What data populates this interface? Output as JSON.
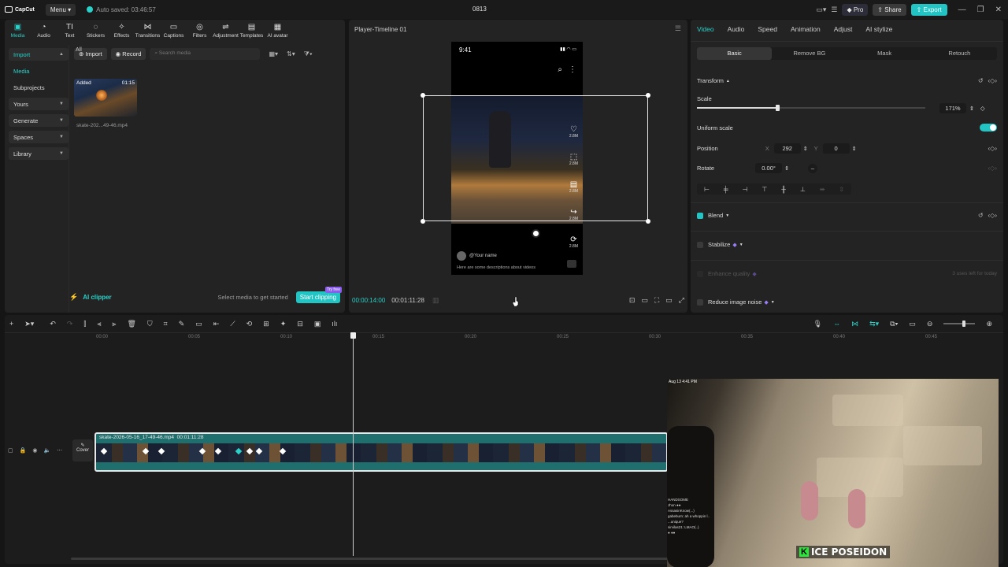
{
  "topbar": {
    "logo": "CapCut",
    "menu": "Menu",
    "autosave": "Auto saved: 03:46:57",
    "doc_title": "0813",
    "pro": "Pro",
    "share": "Share",
    "export": "Export"
  },
  "left": {
    "tools": [
      {
        "label": "Media",
        "icon": "media-icon",
        "glyph": "▣"
      },
      {
        "label": "Audio",
        "icon": "audio-icon",
        "glyph": "◔"
      },
      {
        "label": "Text",
        "icon": "text-icon",
        "glyph": "TI"
      },
      {
        "label": "Stickers",
        "icon": "stickers-icon",
        "glyph": "◌"
      },
      {
        "label": "Effects",
        "icon": "effects-icon",
        "glyph": "✧"
      },
      {
        "label": "Transitions",
        "icon": "transitions-icon",
        "glyph": "⋈"
      },
      {
        "label": "Captions",
        "icon": "captions-icon",
        "glyph": "▭"
      },
      {
        "label": "Filters",
        "icon": "filters-icon",
        "glyph": "◎"
      },
      {
        "label": "Adjustment",
        "icon": "adjustment-icon",
        "glyph": "⇌"
      },
      {
        "label": "Templates",
        "icon": "templates-icon",
        "glyph": "▤"
      },
      {
        "label": "AI avatar",
        "icon": "ai-avatar-icon",
        "glyph": "▦"
      }
    ],
    "nav": [
      {
        "label": "Import",
        "boxed": true,
        "active": true,
        "chevron": "▲"
      },
      {
        "label": "Media",
        "boxed": false,
        "active": true,
        "chevron": ""
      },
      {
        "label": "Subprojects",
        "boxed": false,
        "active": false,
        "chevron": ""
      },
      {
        "label": "Yours",
        "boxed": true,
        "active": false,
        "chevron": "▼"
      },
      {
        "label": "Generate",
        "boxed": true,
        "active": false,
        "chevron": "▼"
      },
      {
        "label": "Spaces",
        "boxed": true,
        "active": false,
        "chevron": "▼"
      },
      {
        "label": "Library",
        "boxed": true,
        "active": false,
        "chevron": "▼"
      }
    ],
    "import_btn": "Import",
    "record_btn": "Record",
    "search_placeholder": "Search media",
    "all_label": "All",
    "media_item": {
      "badge": "Added",
      "duration": "01:15",
      "name": "skate-202...49-46.mp4"
    },
    "clipper_label": "AI clipper",
    "clipper_hint": "Select media to get started",
    "clipper_button": "Start clipping",
    "clipper_tag": "Try free"
  },
  "player": {
    "title": "Player-Timeline 01",
    "phone_time": "9:41",
    "side_counts": [
      "2.8M",
      "2.8M",
      "2.8M",
      "2.8M",
      "2.8M"
    ],
    "user": "@Your name",
    "description": "Here are some descriptions about videos",
    "current_time": "00:00:14:00",
    "total_time": "00:01:11:28"
  },
  "props": {
    "tabs": [
      "Video",
      "Audio",
      "Speed",
      "Animation",
      "Adjust",
      "AI stylize"
    ],
    "sub_tabs": [
      "Basic",
      "Remove BG",
      "Mask",
      "Retouch"
    ],
    "transform": "Transform",
    "scale_label": "Scale",
    "scale_value": "171%",
    "uniform_scale": "Uniform scale",
    "position_label": "Position",
    "pos_x_label": "X",
    "pos_x": "292",
    "pos_y_label": "Y",
    "pos_y": "0",
    "rotate_label": "Rotate",
    "rotate_value": "0.00°",
    "blend": "Blend",
    "stabilize": "Stabilize",
    "enhance_quality": "Enhance quality",
    "enhance_hint": "3 uses left for today",
    "reduce_noise": "Reduce image noise"
  },
  "timeline": {
    "ticks": [
      "00:00",
      "00:05",
      "00:10",
      "00:15",
      "00:20",
      "00:25",
      "00:30",
      "00:35",
      "00:40",
      "00:45"
    ],
    "clip_label": "skate-2026-05-16_17-49-46.mp4",
    "clip_duration": "00:01:11:28",
    "cover": "Cover"
  },
  "webcam": {
    "date": "Aug 13 4:41 PM",
    "chat": [
      "HANDSOME",
      "Jhon ●●",
      "AssasinKnow(...)",
      "gabeburn: ah a whoppin l..",
      "...unique?",
      "sirvilas21: LMAO(..)",
      "● ●●"
    ],
    "brand_letter": "K",
    "brand": "ICE POSEIDON"
  }
}
